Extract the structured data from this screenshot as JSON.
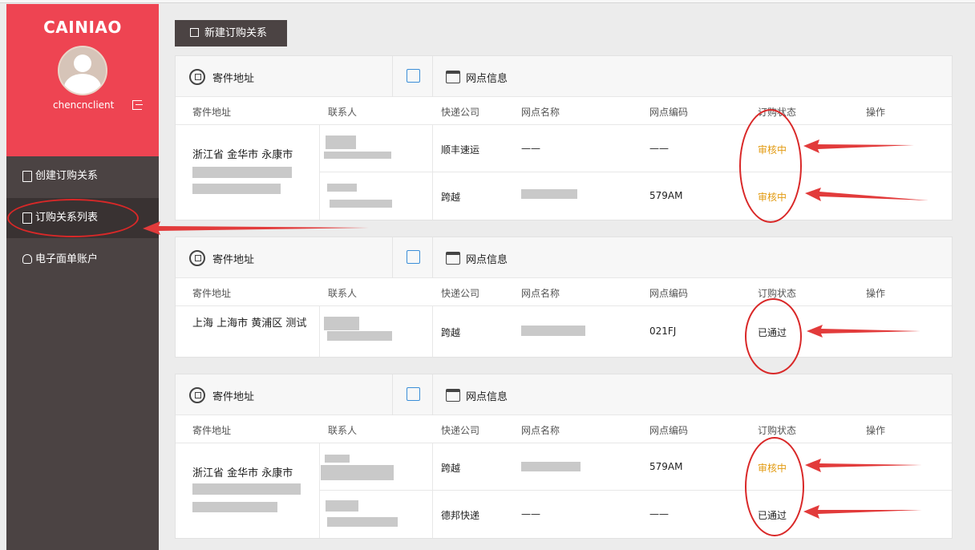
{
  "sidebar": {
    "logo": "CAINIAO",
    "username": "chencnclient",
    "nav": [
      {
        "label": "创建订购关系"
      },
      {
        "label": "订购关系列表"
      },
      {
        "label": "电子面单账户"
      }
    ]
  },
  "toolbar": {
    "new_button": "新建订购关系"
  },
  "columns": [
    "寄件地址",
    "联系人",
    "快递公司",
    "网点名称",
    "网点编码",
    "订购状态",
    "操作"
  ],
  "card_head": {
    "address": "寄件地址",
    "branch": "网点信息"
  },
  "cards": [
    {
      "address_line": "浙江省 金华市 永康市",
      "rows": [
        {
          "company": "顺丰速运",
          "branch_name": "——",
          "branch_code": "——",
          "status": "审核中"
        },
        {
          "company": "跨越",
          "branch_name": "",
          "branch_code": "579AM",
          "status": "审核中"
        }
      ]
    },
    {
      "address_line": "上海 上海市 黄浦区 测试",
      "rows": [
        {
          "company": "跨越",
          "branch_name": "",
          "branch_code": "021FJ",
          "status": "已通过"
        }
      ]
    },
    {
      "address_line": "浙江省 金华市 永康市",
      "rows": [
        {
          "company": "跨越",
          "branch_name": "",
          "branch_code": "579AM",
          "status": "审核中"
        },
        {
          "company": "德邦快递",
          "branch_name": "——",
          "branch_code": "——",
          "status": "已通过"
        }
      ]
    }
  ],
  "colors": {
    "sidebar_red": "#ee4452",
    "sidebar_dark": "#4b4343",
    "review": "#e29a10",
    "annotation": "#d92828",
    "edit_blue": "#3b8ed8"
  }
}
